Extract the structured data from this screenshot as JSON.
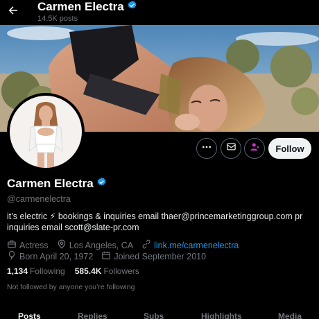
{
  "header": {
    "name": "Carmen Electra",
    "posts_count": "14.5K posts"
  },
  "profile": {
    "name": "Carmen Electra",
    "handle": "@carmenelectra",
    "bio_line1": "it’s electric ⚡ bookings & inquiries email thaer@princemarketinggroup.com   pr",
    "bio_line2": "inquiries email scott@slate-pr.com",
    "category": "Actress",
    "location": "Los Angeles, CA",
    "website": "link.me/carmenelectra",
    "born": "Born April 20, 1972",
    "joined": "Joined September 2010",
    "following_count": "1,134",
    "following_label": "Following",
    "followers_count": "585.4K",
    "followers_label": "Followers",
    "not_followed_note": "Not followed by anyone you’re following"
  },
  "actions": {
    "follow_label": "Follow"
  },
  "tabs": [
    {
      "label": "Posts",
      "active": true
    },
    {
      "label": "Replies",
      "active": false
    },
    {
      "label": "Subs",
      "active": false
    },
    {
      "label": "Highlights",
      "active": false
    },
    {
      "label": "Media",
      "active": false
    }
  ],
  "colors": {
    "verified": "#1d9bf0",
    "link": "#1d9bf0",
    "subscribe_accent": "#c936c9"
  }
}
